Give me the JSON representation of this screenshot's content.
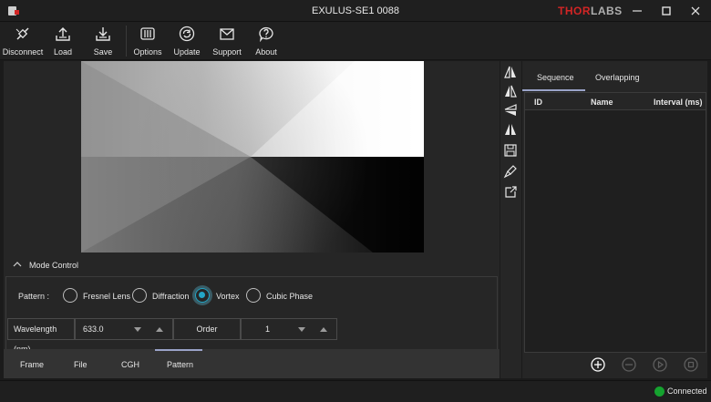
{
  "window": {
    "title": "EXULUS-SE1 0088",
    "logo_main": "THOR",
    "logo_accent": "LABS"
  },
  "toolbar": {
    "disconnect": "Disconnect",
    "load": "Load",
    "save": "Save",
    "options": "Options",
    "update": "Update",
    "support": "Support",
    "about": "About"
  },
  "mode_control": {
    "title": "Mode Control",
    "pattern_label": "Pattern :",
    "options": [
      "Fresnel Lens",
      "Diffraction",
      "Vortex",
      "Cubic Phase"
    ],
    "selected": "Vortex",
    "wavelength_label": "Wavelength (nm)",
    "wavelength_value": "633.0",
    "order_label": "Order",
    "order_value": "1"
  },
  "bottom_tabs": [
    "Frame",
    "File",
    "CGH",
    "Pattern"
  ],
  "bottom_tabs_active": "Pattern",
  "sequence": {
    "tabs": [
      "Sequence",
      "Overlapping"
    ],
    "active_tab": "Sequence",
    "columns": [
      "ID",
      "Name",
      "Interval (ms)"
    ]
  },
  "sidebar_icons": [
    "flip-horizontal-icon",
    "flip-vertical-icon",
    "rotate-icon",
    "mirror-icon",
    "save-icon",
    "clear-icon",
    "export-icon"
  ],
  "status": {
    "text": "Connected",
    "color": "#15a22f"
  },
  "colors": {
    "accent": "#23a6c6",
    "brand_red": "#d32525"
  }
}
